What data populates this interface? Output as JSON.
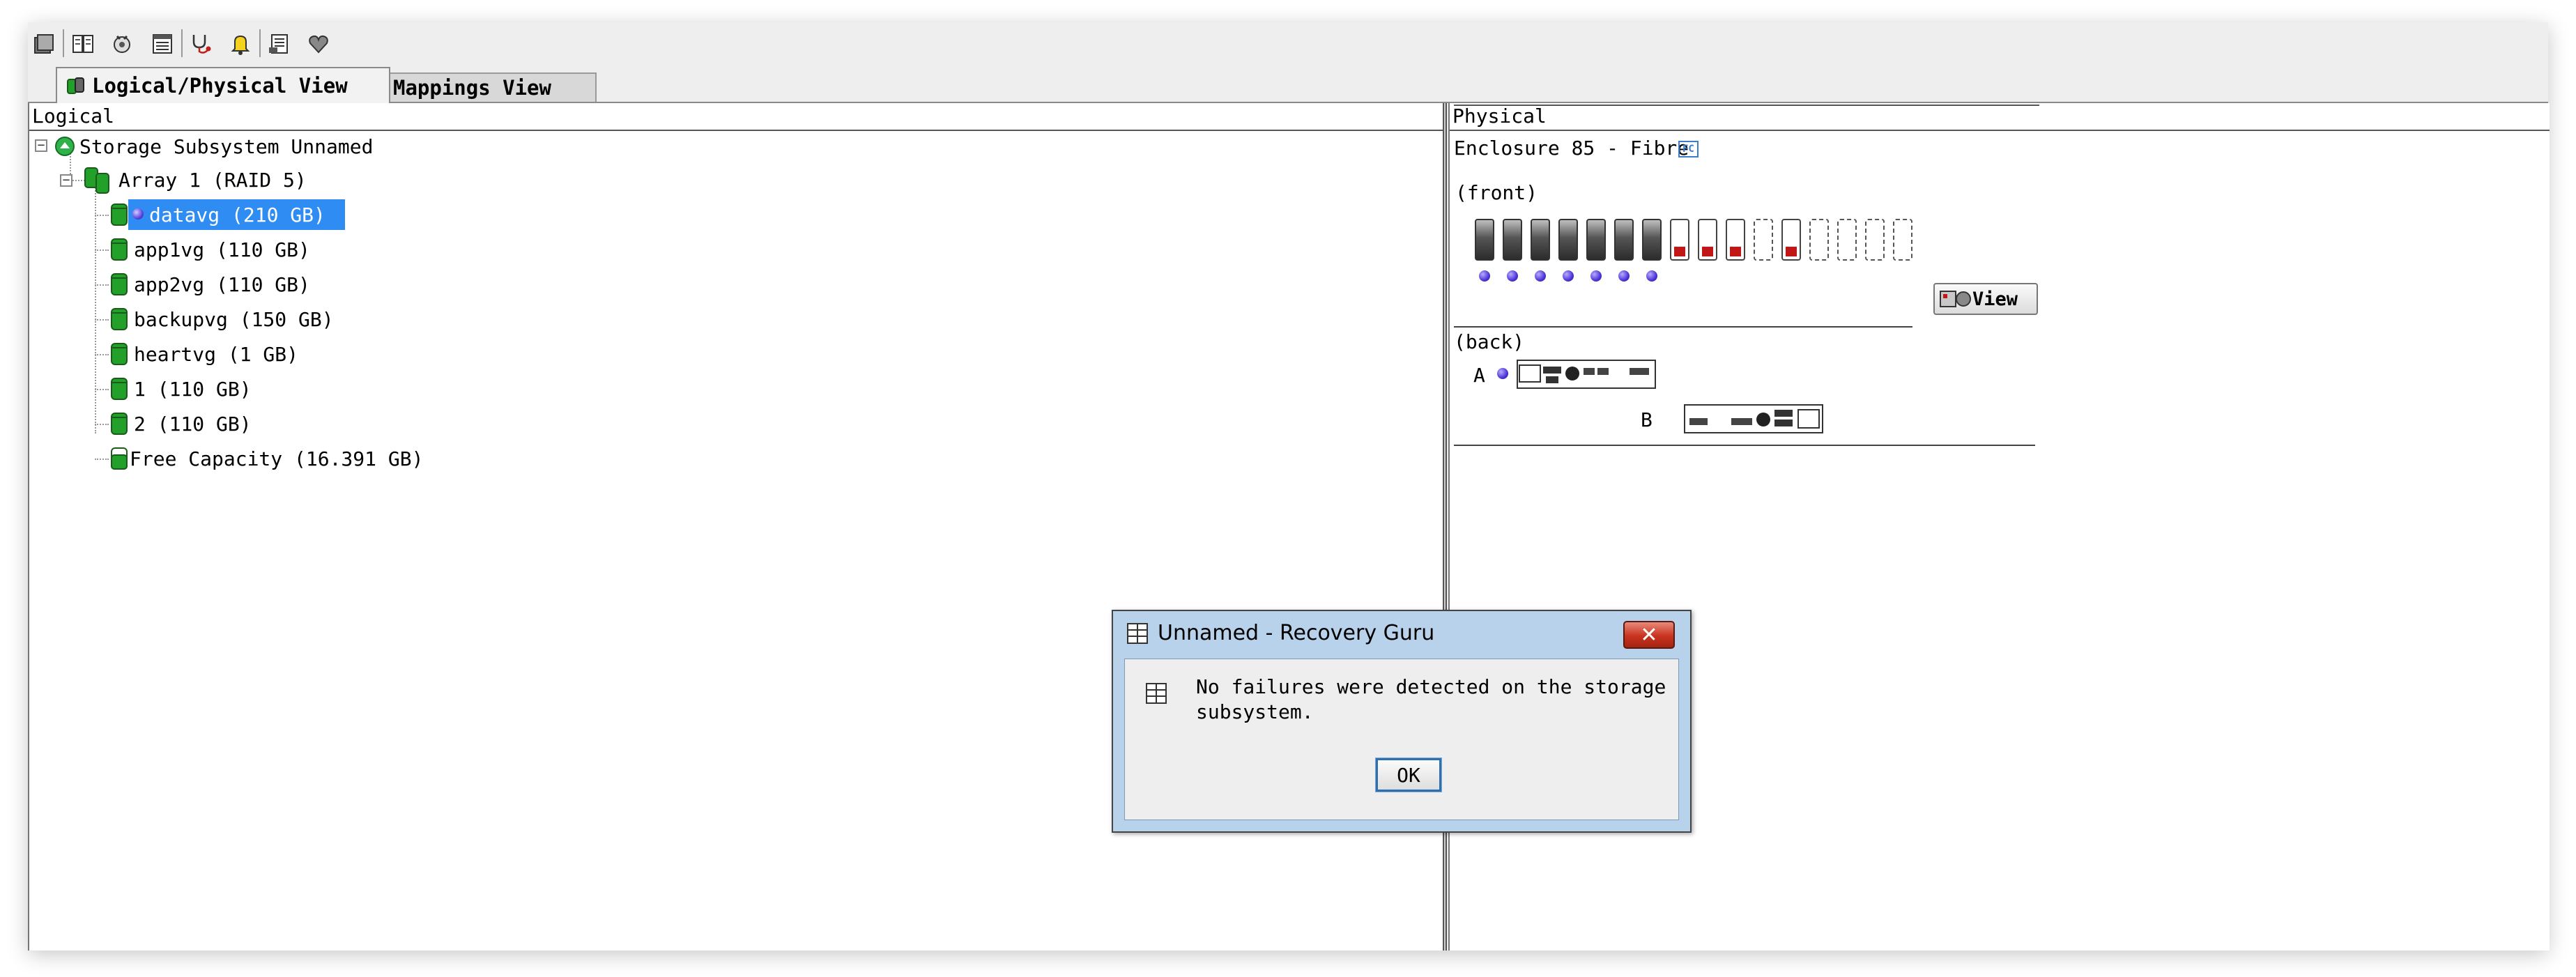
{
  "toolbar": {
    "icons": [
      "storage-subsystem-icon",
      "book-icon",
      "settings-gear-icon",
      "list-icon",
      "stethoscope-icon",
      "alert-bell-icon",
      "script-icon",
      "health-heart-icon"
    ]
  },
  "tabs": {
    "logical_physical": "Logical/Physical View",
    "mappings": "Mappings View"
  },
  "logical": {
    "header": "Logical",
    "root": "Storage Subsystem Unnamed",
    "array": "Array 1 (RAID 5)",
    "volumes": [
      "datavg (210 GB)",
      "app1vg (110 GB)",
      "app2vg (110 GB)",
      "backupvg (150 GB)",
      "heartvg (1 GB)",
      "1 (110 GB)",
      "2 (110 GB)"
    ],
    "free_capacity": "Free Capacity (16.391 GB)"
  },
  "physical": {
    "header": "Physical",
    "enclosure": "Enclosure 85 - Fibre",
    "enclosure_badge": "FC",
    "front_label": "(front)",
    "back_label": "(back)",
    "controller_a": "A",
    "controller_b": "B",
    "view_button": "View",
    "drives": [
      "filled",
      "filled",
      "filled",
      "filled",
      "filled",
      "filled",
      "filled",
      "hotspare",
      "hotspare",
      "hotspare",
      "empty",
      "hotspare",
      "empty",
      "empty",
      "empty",
      "empty"
    ]
  },
  "dialog": {
    "title": "Unnamed - Recovery Guru",
    "message": "No failures were detected on the storage subsystem.",
    "ok": "OK"
  },
  "colors": {
    "selection": "#2f8cf3",
    "dialog_frame": "#b9d2ec",
    "close_button": "#c8331f",
    "led": "#4b34d6",
    "volume_green": "#22a02a"
  }
}
